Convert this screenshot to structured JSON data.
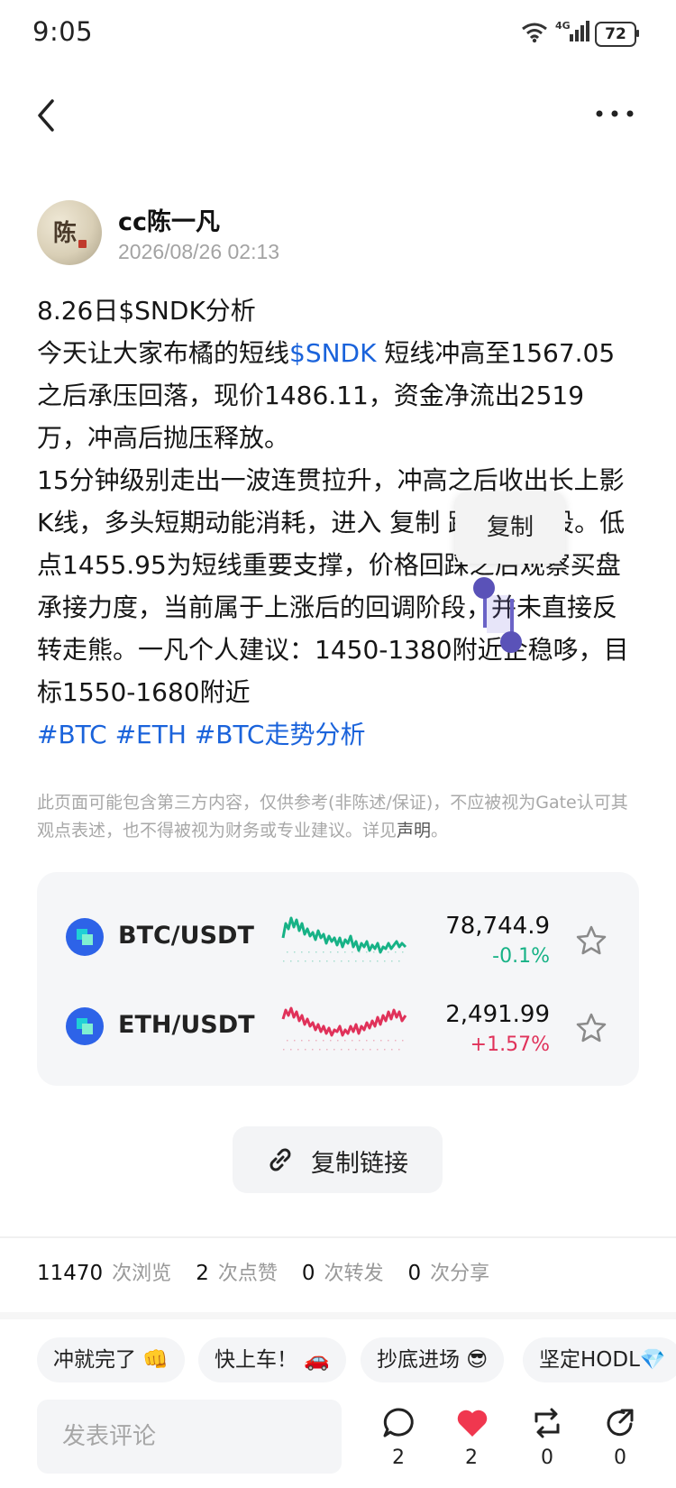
{
  "status": {
    "time": "9:05",
    "battery": "72",
    "network": "4G"
  },
  "nav": {
    "back_icon": "chevron-left-icon",
    "more_icon": "more-horizontal-icon"
  },
  "author": {
    "name": "cc陈一凡",
    "date": "2026/08/26 02:13",
    "avatar_char": "陈"
  },
  "post": {
    "title": "8.26日$SNDK分析",
    "p1_pre": "今天让大家布橘的短线",
    "p1_link": "$SNDK",
    "p1_post": " 短线冲高至1567.05之后承压回落，现价1486.11，资金净流出2519万，冲高后抛压释放。",
    "p2": "15分钟级别走出一波连贯拉升，冲高之后收出长上影K线，多头短期动能消耗，进入 复制 踩修复阶段。低点1455.95为短线重要支撑，价格回踩之后观察买盘承接力度，当前属于上涨后的回调阶段，并未直接反转走熊。一凡个人建议：1450-1380附近企稳哆，目标1550-1680附近",
    "tags": "#BTC #ETH #BTC走势分析"
  },
  "popup": {
    "copy_label": "复制"
  },
  "disclaimer": {
    "text": "此页面可能包含第三方内容，仅供参考(非陈述/保证)，不应被视为Gate认可其观点表述，也不得被视为财务或专业建议。详见",
    "link": "声明",
    "end": "。"
  },
  "tickers": [
    {
      "pair": "BTC/USDT",
      "price": "78,744.9",
      "change": "-0.1%",
      "direction": "down",
      "color": "#17b286"
    },
    {
      "pair": "ETH/USDT",
      "price": "2,491.99",
      "change": "+1.57%",
      "direction": "up",
      "color": "#e0325a"
    }
  ],
  "copy_link": {
    "label": "复制链接",
    "icon": "link-icon"
  },
  "stats": [
    {
      "n": "11470",
      "label": "次浏览"
    },
    {
      "n": "2",
      "label": "次点赞"
    },
    {
      "n": "0",
      "label": "次转发"
    },
    {
      "n": "0",
      "label": "次分享"
    }
  ],
  "quick_replies": [
    "冲就完了 👊",
    "快上车！ 🚗",
    "抄底进场 😎",
    "坚定HODL💎"
  ],
  "comment": {
    "placeholder": "发表评论",
    "actions": [
      {
        "icon": "comment-icon",
        "count": "2"
      },
      {
        "icon": "heart-icon",
        "count": "2"
      },
      {
        "icon": "repost-icon",
        "count": "0"
      },
      {
        "icon": "share-icon",
        "count": "0"
      }
    ]
  },
  "colors": {
    "link": "#1a63db",
    "up": "#e0325a",
    "down": "#17b286",
    "accent": "#2d63e8"
  }
}
